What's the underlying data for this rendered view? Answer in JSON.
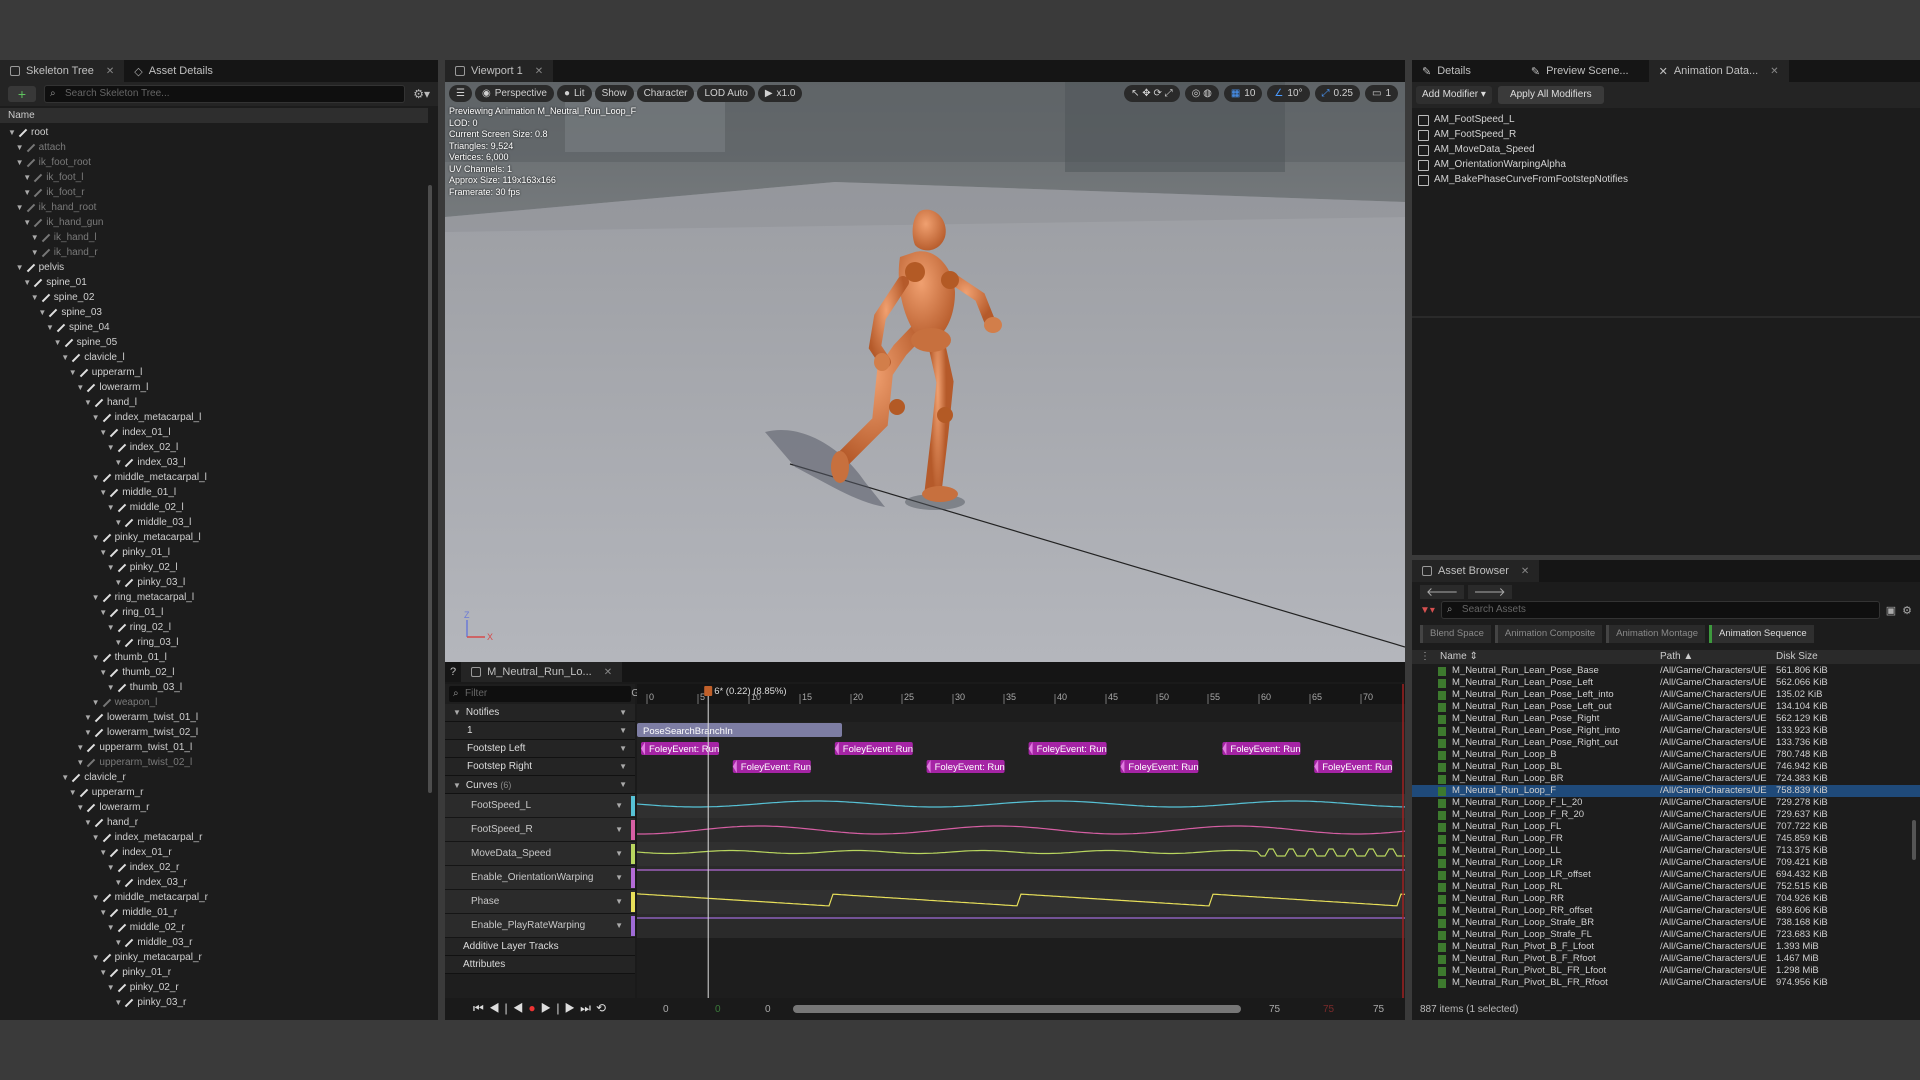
{
  "skeleton_panel": {
    "tabs": [
      "Skeleton Tree",
      "Asset Details"
    ],
    "search_placeholder": "Search Skeleton Tree...",
    "column_name": "Name",
    "bones": [
      {
        "name": "root",
        "depth": 0,
        "dim": false
      },
      {
        "name": "attach",
        "depth": 1,
        "dim": true
      },
      {
        "name": "ik_foot_root",
        "depth": 1,
        "dim": true
      },
      {
        "name": "ik_foot_l",
        "depth": 2,
        "dim": true
      },
      {
        "name": "ik_foot_r",
        "depth": 2,
        "dim": true
      },
      {
        "name": "ik_hand_root",
        "depth": 1,
        "dim": true
      },
      {
        "name": "ik_hand_gun",
        "depth": 2,
        "dim": true
      },
      {
        "name": "ik_hand_l",
        "depth": 3,
        "dim": true
      },
      {
        "name": "ik_hand_r",
        "depth": 3,
        "dim": true
      },
      {
        "name": "pelvis",
        "depth": 1,
        "dim": false
      },
      {
        "name": "spine_01",
        "depth": 2,
        "dim": false
      },
      {
        "name": "spine_02",
        "depth": 3,
        "dim": false
      },
      {
        "name": "spine_03",
        "depth": 4,
        "dim": false
      },
      {
        "name": "spine_04",
        "depth": 5,
        "dim": false
      },
      {
        "name": "spine_05",
        "depth": 6,
        "dim": false
      },
      {
        "name": "clavicle_l",
        "depth": 7,
        "dim": false
      },
      {
        "name": "upperarm_l",
        "depth": 8,
        "dim": false
      },
      {
        "name": "lowerarm_l",
        "depth": 9,
        "dim": false
      },
      {
        "name": "hand_l",
        "depth": 10,
        "dim": false
      },
      {
        "name": "index_metacarpal_l",
        "depth": 11,
        "dim": false
      },
      {
        "name": "index_01_l",
        "depth": 12,
        "dim": false
      },
      {
        "name": "index_02_l",
        "depth": 13,
        "dim": false
      },
      {
        "name": "index_03_l",
        "depth": 14,
        "dim": false
      },
      {
        "name": "middle_metacarpal_l",
        "depth": 11,
        "dim": false
      },
      {
        "name": "middle_01_l",
        "depth": 12,
        "dim": false
      },
      {
        "name": "middle_02_l",
        "depth": 13,
        "dim": false
      },
      {
        "name": "middle_03_l",
        "depth": 14,
        "dim": false
      },
      {
        "name": "pinky_metacarpal_l",
        "depth": 11,
        "dim": false
      },
      {
        "name": "pinky_01_l",
        "depth": 12,
        "dim": false
      },
      {
        "name": "pinky_02_l",
        "depth": 13,
        "dim": false
      },
      {
        "name": "pinky_03_l",
        "depth": 14,
        "dim": false
      },
      {
        "name": "ring_metacarpal_l",
        "depth": 11,
        "dim": false
      },
      {
        "name": "ring_01_l",
        "depth": 12,
        "dim": false
      },
      {
        "name": "ring_02_l",
        "depth": 13,
        "dim": false
      },
      {
        "name": "ring_03_l",
        "depth": 14,
        "dim": false
      },
      {
        "name": "thumb_01_l",
        "depth": 11,
        "dim": false
      },
      {
        "name": "thumb_02_l",
        "depth": 12,
        "dim": false
      },
      {
        "name": "thumb_03_l",
        "depth": 13,
        "dim": false
      },
      {
        "name": "weapon_l",
        "depth": 11,
        "dim": true
      },
      {
        "name": "lowerarm_twist_01_l",
        "depth": 10,
        "dim": false
      },
      {
        "name": "lowerarm_twist_02_l",
        "depth": 10,
        "dim": false
      },
      {
        "name": "upperarm_twist_01_l",
        "depth": 9,
        "dim": false
      },
      {
        "name": "upperarm_twist_02_l",
        "depth": 9,
        "dim": true
      },
      {
        "name": "clavicle_r",
        "depth": 7,
        "dim": false
      },
      {
        "name": "upperarm_r",
        "depth": 8,
        "dim": false
      },
      {
        "name": "lowerarm_r",
        "depth": 9,
        "dim": false
      },
      {
        "name": "hand_r",
        "depth": 10,
        "dim": false
      },
      {
        "name": "index_metacarpal_r",
        "depth": 11,
        "dim": false
      },
      {
        "name": "index_01_r",
        "depth": 12,
        "dim": false
      },
      {
        "name": "index_02_r",
        "depth": 13,
        "dim": false
      },
      {
        "name": "index_03_r",
        "depth": 14,
        "dim": false
      },
      {
        "name": "middle_metacarpal_r",
        "depth": 11,
        "dim": false
      },
      {
        "name": "middle_01_r",
        "depth": 12,
        "dim": false
      },
      {
        "name": "middle_02_r",
        "depth": 13,
        "dim": false
      },
      {
        "name": "middle_03_r",
        "depth": 14,
        "dim": false
      },
      {
        "name": "pinky_metacarpal_r",
        "depth": 11,
        "dim": false
      },
      {
        "name": "pinky_01_r",
        "depth": 12,
        "dim": false
      },
      {
        "name": "pinky_02_r",
        "depth": 13,
        "dim": false
      },
      {
        "name": "pinky_03_r",
        "depth": 14,
        "dim": false
      }
    ]
  },
  "viewport": {
    "tab": "Viewport 1",
    "buttons": {
      "perspective": "Perspective",
      "lit": "Lit",
      "show": "Show",
      "character": "Character",
      "lod": "LOD Auto",
      "speed": "x1.0"
    },
    "right_values": {
      "grid": "10",
      "angle": "10°",
      "scale": "0.25",
      "cam": "1"
    },
    "stats": [
      "Previewing Animation M_Neutral_Run_Loop_F",
      "LOD: 0",
      "Current Screen Size: 0.8",
      "Triangles: 9,524",
      "Vertices: 6,000",
      "UV Channels: 1",
      "Approx Size: 119x163x166",
      "Framerate: 30 fps"
    ]
  },
  "sequencer": {
    "tab": "M_Neutral_Run_Lo...",
    "filter_placeholder": "Filter",
    "playhead_label": "6* (0.22) (8.85%)",
    "ruler": [
      "0",
      "5",
      "10",
      "15",
      "20",
      "25",
      "30",
      "35",
      "40",
      "45",
      "50",
      "55",
      "60",
      "65",
      "70"
    ],
    "tracks": {
      "notifies": "Notifies",
      "track1": "1",
      "footstep_left": "Footstep Left",
      "footstep_right": "Footstep Right",
      "curves": "Curves",
      "curves_count": "(6)",
      "additive": "Additive Layer Tracks",
      "attributes": "Attributes"
    },
    "curves": [
      {
        "name": "FootSpeed_L",
        "color": "#57c2d6"
      },
      {
        "name": "FootSpeed_R",
        "color": "#d65fa4"
      },
      {
        "name": "MoveData_Speed",
        "color": "#b9d65f"
      },
      {
        "name": "Enable_OrientationWarping",
        "color": "#b36bd6"
      },
      {
        "name": "Phase",
        "color": "#e8e05a"
      },
      {
        "name": "Enable_PlayRateWarping",
        "color": "#9f6bd6"
      }
    ],
    "branch_notify": "PoseSearchBranchIn",
    "foley_label": "FoleyEvent: Run",
    "left_foley_frames": [
      0,
      19,
      38,
      57
    ],
    "right_foley_frames": [
      9,
      28,
      47,
      66
    ],
    "transport_left_values": [
      "0",
      "0",
      "0"
    ],
    "transport_right_values": [
      "75",
      "75",
      "75"
    ]
  },
  "details": {
    "tabs": [
      "Details",
      "Preview Scene...",
      "Animation Data..."
    ],
    "add_modifier": "Add Modifier",
    "apply_all": "Apply All Modifiers",
    "modifiers": [
      "AM_FootSpeed_L",
      "AM_FootSpeed_R",
      "AM_MoveData_Speed",
      "AM_OrientationWarpingAlpha",
      "AM_BakePhaseCurveFromFootstepNotifies"
    ]
  },
  "asset_browser": {
    "tab": "Asset Browser",
    "search_placeholder": "Search Assets",
    "filters": [
      "Blend Space",
      "Animation Composite",
      "Animation Montage",
      "Animation Sequence"
    ],
    "columns": {
      "name": "Name",
      "path": "Path",
      "size": "Disk Size"
    },
    "rows": [
      {
        "name": "M_Neutral_Run_Lean_Pose_Base",
        "path": "/All/Game/Characters/UE",
        "size": "561.806 KiB"
      },
      {
        "name": "M_Neutral_Run_Lean_Pose_Left",
        "path": "/All/Game/Characters/UE",
        "size": "562.066 KiB"
      },
      {
        "name": "M_Neutral_Run_Lean_Pose_Left_into",
        "path": "/All/Game/Characters/UE",
        "size": "135.02 KiB"
      },
      {
        "name": "M_Neutral_Run_Lean_Pose_Left_out",
        "path": "/All/Game/Characters/UE",
        "size": "134.104 KiB"
      },
      {
        "name": "M_Neutral_Run_Lean_Pose_Right",
        "path": "/All/Game/Characters/UE",
        "size": "562.129 KiB"
      },
      {
        "name": "M_Neutral_Run_Lean_Pose_Right_into",
        "path": "/All/Game/Characters/UE",
        "size": "133.923 KiB"
      },
      {
        "name": "M_Neutral_Run_Lean_Pose_Right_out",
        "path": "/All/Game/Characters/UE",
        "size": "133.736 KiB"
      },
      {
        "name": "M_Neutral_Run_Loop_B",
        "path": "/All/Game/Characters/UE",
        "size": "780.748 KiB"
      },
      {
        "name": "M_Neutral_Run_Loop_BL",
        "path": "/All/Game/Characters/UE",
        "size": "746.942 KiB"
      },
      {
        "name": "M_Neutral_Run_Loop_BR",
        "path": "/All/Game/Characters/UE",
        "size": "724.383 KiB"
      },
      {
        "name": "M_Neutral_Run_Loop_F",
        "path": "/All/Game/Characters/UE",
        "size": "758.839 KiB",
        "selected": true
      },
      {
        "name": "M_Neutral_Run_Loop_F_L_20",
        "path": "/All/Game/Characters/UE",
        "size": "729.278 KiB"
      },
      {
        "name": "M_Neutral_Run_Loop_F_R_20",
        "path": "/All/Game/Characters/UE",
        "size": "729.637 KiB"
      },
      {
        "name": "M_Neutral_Run_Loop_FL",
        "path": "/All/Game/Characters/UE",
        "size": "707.722 KiB"
      },
      {
        "name": "M_Neutral_Run_Loop_FR",
        "path": "/All/Game/Characters/UE",
        "size": "745.859 KiB"
      },
      {
        "name": "M_Neutral_Run_Loop_LL",
        "path": "/All/Game/Characters/UE",
        "size": "713.375 KiB"
      },
      {
        "name": "M_Neutral_Run_Loop_LR",
        "path": "/All/Game/Characters/UE",
        "size": "709.421 KiB"
      },
      {
        "name": "M_Neutral_Run_Loop_LR_offset",
        "path": "/All/Game/Characters/UE",
        "size": "694.432 KiB"
      },
      {
        "name": "M_Neutral_Run_Loop_RL",
        "path": "/All/Game/Characters/UE",
        "size": "752.515 KiB"
      },
      {
        "name": "M_Neutral_Run_Loop_RR",
        "path": "/All/Game/Characters/UE",
        "size": "704.926 KiB"
      },
      {
        "name": "M_Neutral_Run_Loop_RR_offset",
        "path": "/All/Game/Characters/UE",
        "size": "689.606 KiB"
      },
      {
        "name": "M_Neutral_Run_Loop_Strafe_BR",
        "path": "/All/Game/Characters/UE",
        "size": "738.168 KiB"
      },
      {
        "name": "M_Neutral_Run_Loop_Strafe_FL",
        "path": "/All/Game/Characters/UE",
        "size": "723.683 KiB"
      },
      {
        "name": "M_Neutral_Run_Pivot_B_F_Lfoot",
        "path": "/All/Game/Characters/UE",
        "size": "1.393 MiB"
      },
      {
        "name": "M_Neutral_Run_Pivot_B_F_Rfoot",
        "path": "/All/Game/Characters/UE",
        "size": "1.467 MiB"
      },
      {
        "name": "M_Neutral_Run_Pivot_BL_FR_Lfoot",
        "path": "/All/Game/Characters/UE",
        "size": "1.298 MiB"
      },
      {
        "name": "M_Neutral_Run_Pivot_BL_FR_Rfoot",
        "path": "/All/Game/Characters/UE",
        "size": "974.956 KiB"
      }
    ],
    "status": "887 items (1 selected)"
  }
}
